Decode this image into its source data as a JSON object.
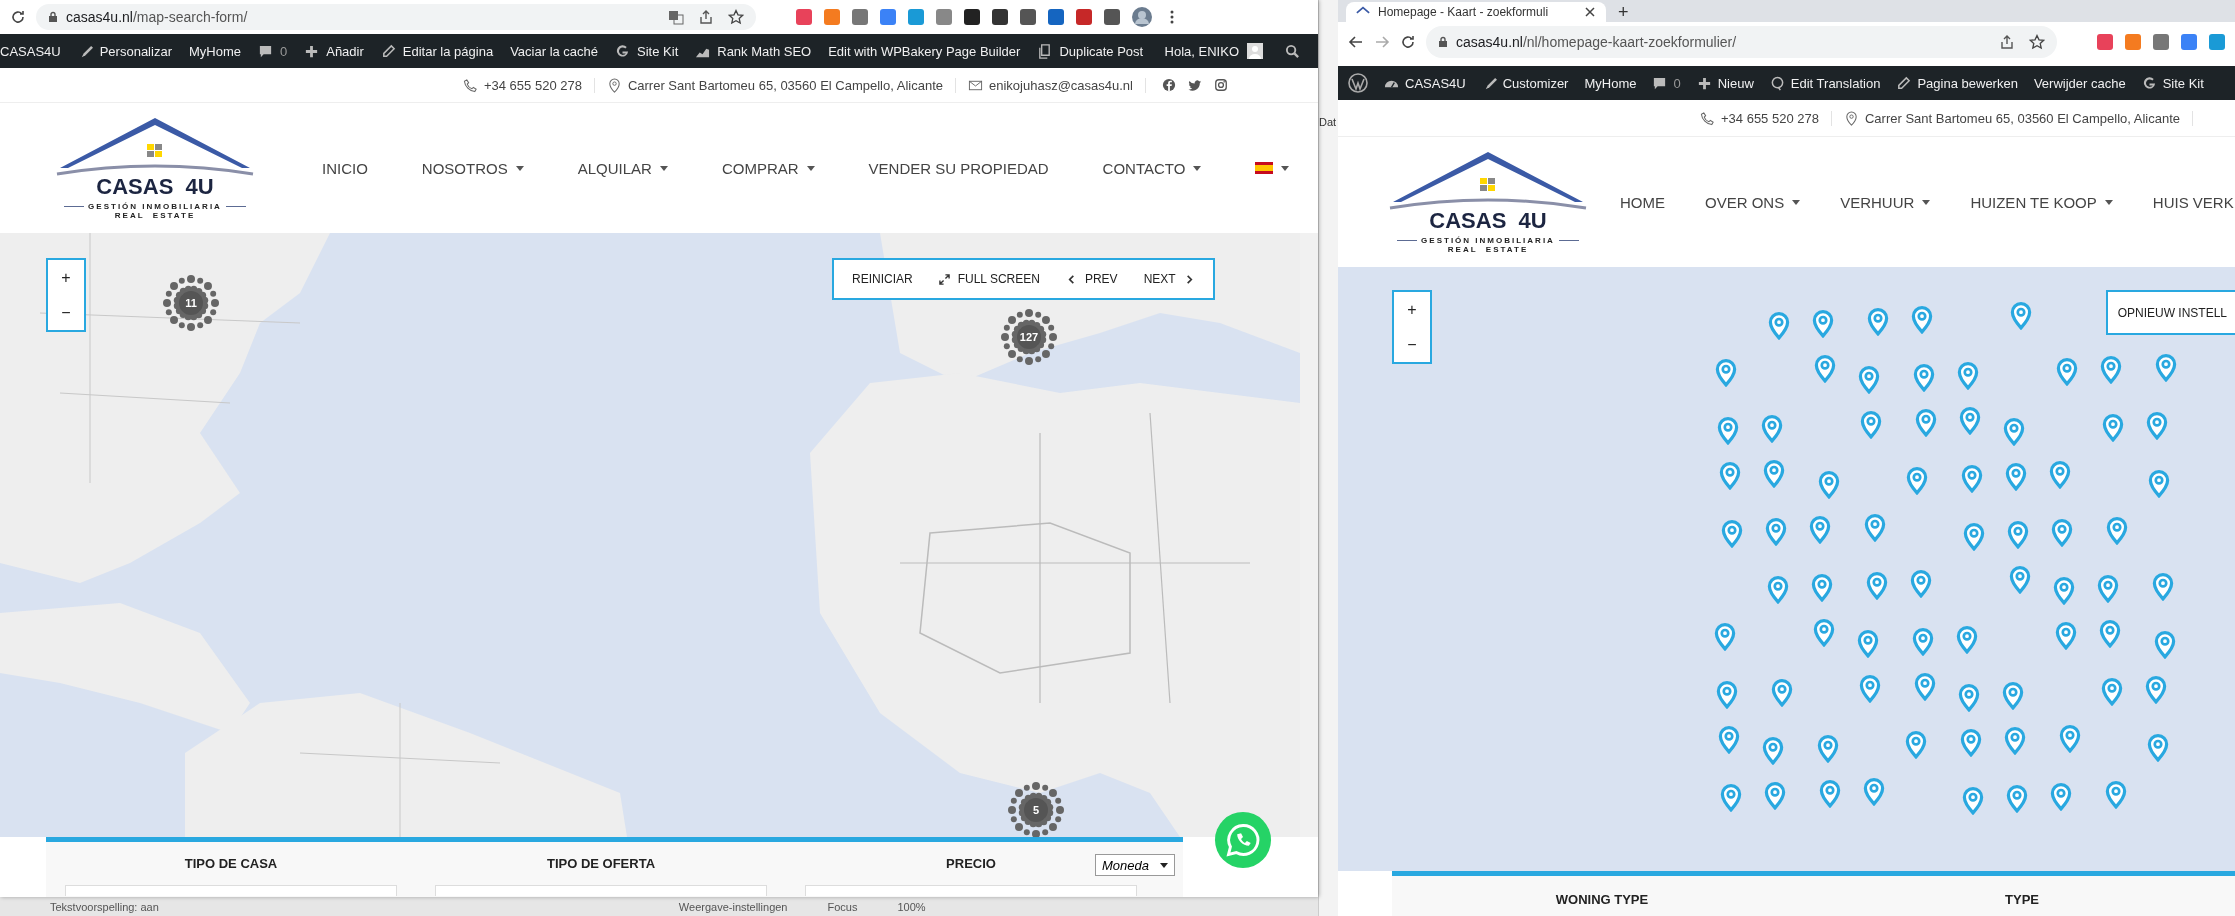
{
  "left_window": {
    "address": {
      "domain": "casas4u.nl",
      "path": "/map-search-form/"
    },
    "admin_bar": [
      {
        "kind": "text",
        "label": "CASAS4U"
      },
      {
        "kind": "brush",
        "label": "Personalizar"
      },
      {
        "kind": "text",
        "label": "MyHome"
      },
      {
        "kind": "comments",
        "label": "0"
      },
      {
        "kind": "plus",
        "label": "Añadir"
      },
      {
        "kind": "pencil",
        "label": "Editar la página"
      },
      {
        "kind": "text",
        "label": "Vaciar la caché"
      },
      {
        "kind": "google",
        "label": "Site Kit"
      },
      {
        "kind": "chart",
        "label": "Rank Math SEO"
      },
      {
        "kind": "text",
        "label": "Edit with WPBakery Page Builder"
      },
      {
        "kind": "copy",
        "label": "Duplicate Post"
      }
    ],
    "greeting": "Hola, ENIKO",
    "contact": [
      {
        "kind": "phone",
        "text": "+34 655 520 278"
      },
      {
        "kind": "address",
        "text": "Carrer Sant Bartomeu 65, 03560 El Campello, Alicante"
      },
      {
        "kind": "email",
        "text": "enikojuhasz@casas4u.nl"
      }
    ],
    "logo": {
      "name": "CASAS  4U",
      "tagline": "GESTIÓN INMOBILIARIA",
      "sub": "REAL  ESTATE"
    },
    "nav": [
      {
        "kind": "text",
        "label": "INICIO",
        "dropdown": false
      },
      {
        "kind": "text",
        "label": "NOSOTROS",
        "dropdown": true
      },
      {
        "kind": "text",
        "label": "ALQUILAR",
        "dropdown": true
      },
      {
        "kind": "text",
        "label": "COMPRAR",
        "dropdown": true
      },
      {
        "kind": "text",
        "label": "VENDER SU PROPIEDAD",
        "dropdown": false
      },
      {
        "kind": "text",
        "label": "CONTACTO",
        "dropdown": true
      },
      {
        "kind": "flag",
        "dropdown": true
      }
    ],
    "zoom_buttons": [
      "+",
      "−"
    ],
    "map_controls": [
      {
        "kind": "reset",
        "label": "REINICIAR"
      },
      {
        "kind": "fullscreen",
        "label": "FULL SCREEN"
      },
      {
        "kind": "prev",
        "label": "PREV"
      },
      {
        "kind": "next",
        "label": "NEXT"
      }
    ],
    "clusters": [
      {
        "count": "11"
      },
      {
        "count": "127"
      },
      {
        "count": "5"
      }
    ],
    "search_form": {
      "fields": [
        "TIPO DE CASA",
        "TIPO DE OFERTA",
        "PRECIO"
      ],
      "currency": "Moneda"
    }
  },
  "background_window": {
    "side_text": "Dat",
    "status": [
      "Tekstvoorspelling: aan",
      "Weergave-instellingen",
      "Focus",
      "100%"
    ]
  },
  "right_window": {
    "tab": {
      "title": "Homepage - Kaart - zoekformuli",
      "new_tab": "+"
    },
    "address": {
      "domain": "casas4u.nl",
      "path": "/nl/homepage-kaart-zoekformulier/"
    },
    "admin_bar": [
      {
        "kind": "wp"
      },
      {
        "kind": "dashboard",
        "label": "CASAS4U"
      },
      {
        "kind": "brush",
        "label": "Customizer"
      },
      {
        "kind": "text",
        "label": "MyHome"
      },
      {
        "kind": "comments",
        "label": "0"
      },
      {
        "kind": "plus",
        "label": "Nieuw"
      },
      {
        "kind": "translate",
        "label": "Edit Translation"
      },
      {
        "kind": "pencil",
        "label": "Pagina bewerken"
      },
      {
        "kind": "text",
        "label": "Verwijder cache"
      },
      {
        "kind": "google",
        "label": "Site Kit"
      }
    ],
    "contact": [
      {
        "kind": "phone",
        "text": "+34 655 520 278"
      },
      {
        "kind": "address",
        "text": "Carrer Sant Bartomeu 65, 03560 El Campello, Alicante"
      }
    ],
    "logo": {
      "name": "CASAS  4U",
      "tagline": "GESTIÓN INMOBILIARIA",
      "sub": "REAL  ESTATE"
    },
    "nav": [
      {
        "kind": "text",
        "label": "HOME",
        "dropdown": false
      },
      {
        "kind": "text",
        "label": "OVER ONS",
        "dropdown": true
      },
      {
        "kind": "text",
        "label": "VERHUUR",
        "dropdown": true
      },
      {
        "kind": "text",
        "label": "HUIZEN TE KOOP",
        "dropdown": true
      },
      {
        "kind": "text",
        "label": "HUIS VERK",
        "dropdown": false
      }
    ],
    "zoom_buttons": [
      "+",
      "−"
    ],
    "reset_button": "OPNIEUW INSTELL",
    "search_form": {
      "fields": [
        "WONING TYPE",
        "TYPE"
      ]
    }
  }
}
